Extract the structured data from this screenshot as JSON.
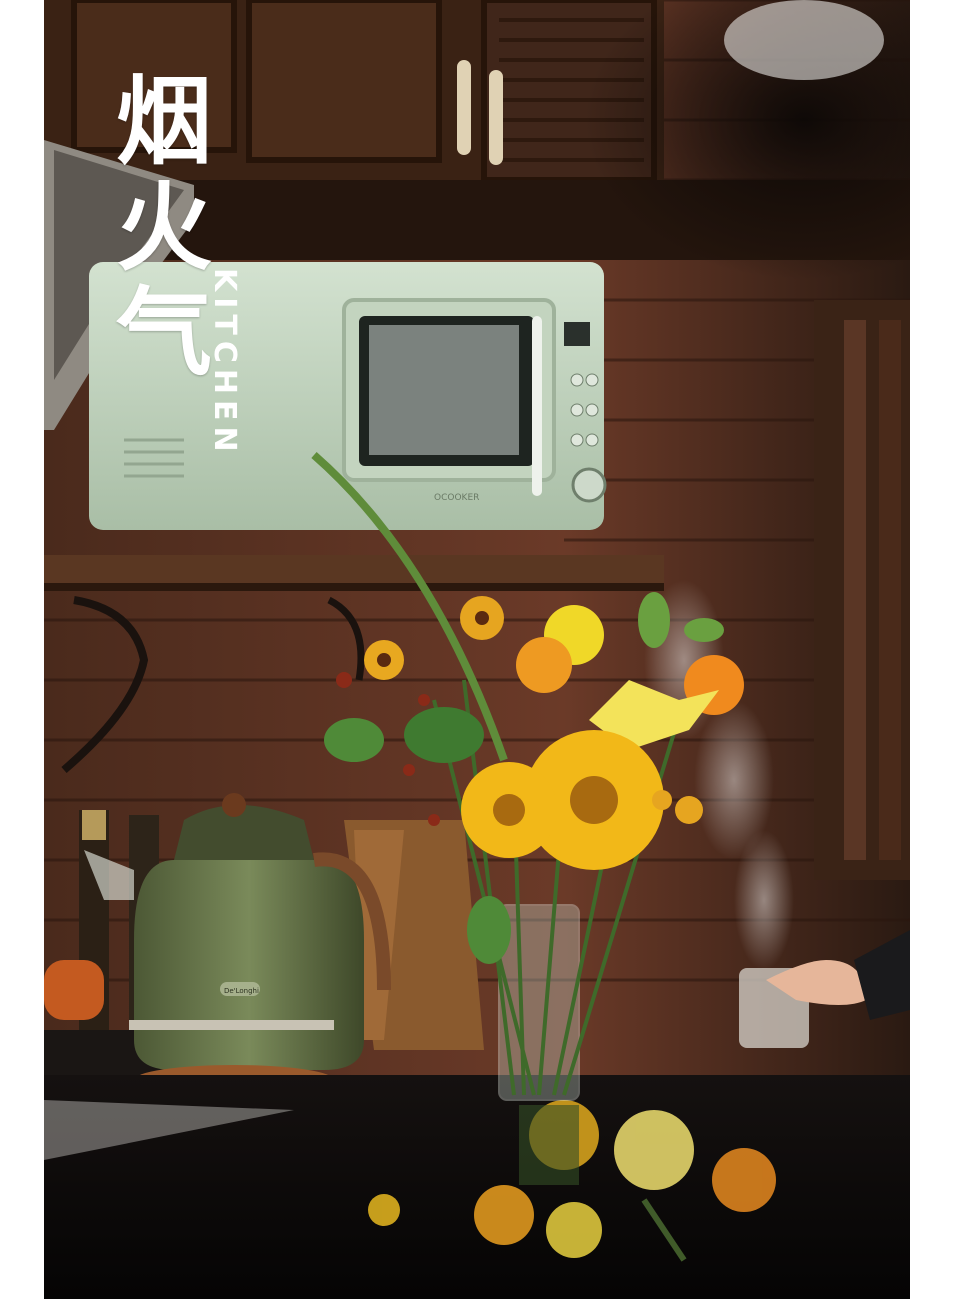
{
  "poster": {
    "title_chars": [
      "烟",
      "火",
      "气"
    ],
    "subtitle": "KITCHEN",
    "microwave_brand": "OCOOKER",
    "kettle_brand": "De'Longhi"
  },
  "colors": {
    "background": "#ffffff",
    "wood_dark": "#3a2214",
    "brick": "#5a3324",
    "microwave_green": "#bcd0bc",
    "kettle_green": "#5f6d45",
    "sunflower_yellow": "#f2b818",
    "counter_black": "#0d0b0a",
    "text": "#ffffff"
  },
  "scene": {
    "objects": [
      "wooden-cabinets",
      "range-hood",
      "microwave",
      "wall-shelf",
      "brick-wall",
      "kettle",
      "knife-block",
      "flower-vase",
      "steaming-cup",
      "hand",
      "countertop-reflection"
    ]
  }
}
